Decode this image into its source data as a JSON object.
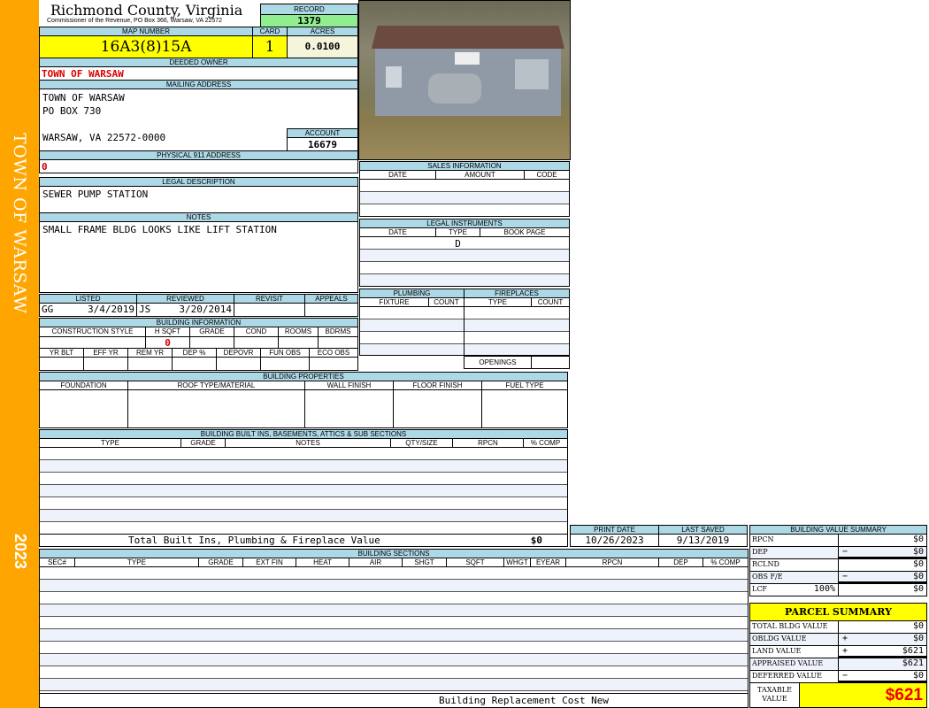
{
  "side": {
    "owner": "TOWN OF WARSAW",
    "year": "2023",
    "color": "#FFA500"
  },
  "header": {
    "title": "Richmond County, Virginia",
    "subtitle": "Commissioner of the Revenue, PO Box 366, Warsaw, VA 22572",
    "record_label": "RECORD",
    "record": "1379"
  },
  "parcel": {
    "map_label": "MAP NUMBER",
    "map": "16A3(8)15A",
    "card_label": "CARD",
    "card": "1",
    "acres_label": "ACRES",
    "acres": "0.0100"
  },
  "owner": {
    "label": "DEEDED OWNER",
    "name": "TOWN OF WARSAW"
  },
  "mailing": {
    "label": "MAILING ADDRESS",
    "line1": "TOWN OF WARSAW",
    "line2": "PO BOX 730",
    "line3": "WARSAW, VA 22572-0000",
    "account_label": "ACCOUNT",
    "account": "16679"
  },
  "physical": {
    "label": "PHYSICAL 911 ADDRESS",
    "value": "0"
  },
  "legal": {
    "label": "LEGAL DESCRIPTION",
    "value": "SEWER PUMP STATION"
  },
  "notes": {
    "label": "NOTES",
    "value": "SMALL FRAME BLDG LOOKS LIKE LIFT STATION"
  },
  "review": {
    "listed_label": "LISTED",
    "listed_by": "GG",
    "listed_date": "3/4/2019",
    "reviewed_label": "REVIEWED",
    "reviewed_by": "JS",
    "reviewed_date": "3/20/2014",
    "revisit_label": "REVISIT",
    "appeals_label": "APPEALS"
  },
  "building_info": {
    "label": "BUILDING INFORMATION",
    "cols1": [
      "CONSTRUCTION STYLE",
      "H SQFT",
      "GRADE",
      "COND",
      "ROOMS",
      "BDRMS"
    ],
    "hsqft": "0",
    "cols2": [
      "YR BLT",
      "EFF YR",
      "REM YR",
      "DEP %",
      "DEPOVR",
      "FUN OBS",
      "ECO OBS"
    ]
  },
  "sales": {
    "label": "SALES INFORMATION",
    "cols": [
      "DATE",
      "AMOUNT",
      "CODE"
    ]
  },
  "instruments": {
    "label": "LEGAL INSTRUMENTS",
    "cols": [
      "DATE",
      "TYPE",
      "BOOK PAGE"
    ],
    "type": "D"
  },
  "plumbing": {
    "label": "PLUMBING",
    "cols": [
      "FIXTURE",
      "COUNT"
    ]
  },
  "fireplaces": {
    "label": "FIREPLACES",
    "cols": [
      "TYPE",
      "COUNT"
    ],
    "openings_label": "OPENINGS"
  },
  "properties": {
    "label": "BUILDING PROPERTIES",
    "cols": [
      "FOUNDATION",
      "ROOF TYPE/MATERIAL",
      "WALL FINISH",
      "FLOOR FINISH",
      "FUEL TYPE"
    ]
  },
  "builtins": {
    "label": "BUILDING BUILT INS, BASEMENTS, ATTICS & SUB SECTIONS",
    "cols": [
      "TYPE",
      "GRADE",
      "NOTES",
      "QTY/SIZE",
      "RPCN",
      "% COMP"
    ],
    "total_label": "Total Built Ins, Plumbing & Fireplace Value",
    "total": "$0"
  },
  "dates": {
    "print_label": "PRINT DATE",
    "print": "10/26/2023",
    "saved_label": "LAST SAVED",
    "saved": "9/13/2019"
  },
  "sections": {
    "label": "BUILDING SECTIONS",
    "cols": [
      "SEC#",
      "TYPE",
      "GRADE",
      "EXT FIN",
      "HEAT",
      "AIR",
      "SHGT",
      "SQFT",
      "WHGT",
      "EYEAR",
      "RPCN",
      "DEP",
      "% COMP"
    ],
    "footer": "Building Replacement Cost New"
  },
  "value_summary": {
    "label": "BUILDING VALUE SUMMARY",
    "rows": [
      {
        "label": "RPCN",
        "sign": "",
        "value": "$0"
      },
      {
        "label": "DEP",
        "sign": "−",
        "value": "$0"
      },
      {
        "label": "RCLND",
        "sign": "",
        "value": "$0"
      },
      {
        "label": "OBS F/E",
        "sign": "−",
        "value": "$0"
      },
      {
        "label": "LCF",
        "pct": "100%",
        "sign": "",
        "value": "$0"
      }
    ]
  },
  "parcel_summary": {
    "label": "PARCEL SUMMARY",
    "rows": [
      {
        "label": "TOTAL BLDG VALUE",
        "sign": "",
        "value": "$0"
      },
      {
        "label": "OBLDG VALUE",
        "sign": "+",
        "value": "$0"
      },
      {
        "label": "LAND VALUE",
        "sign": "+",
        "value": "$621"
      },
      {
        "label": "APPRAISED VALUE",
        "sign": "",
        "value": "$621"
      },
      {
        "label": "DEFERRED VALUE",
        "sign": "−",
        "value": "$0"
      }
    ],
    "taxable_label": "TAXABLE VALUE",
    "taxable": "$621"
  }
}
